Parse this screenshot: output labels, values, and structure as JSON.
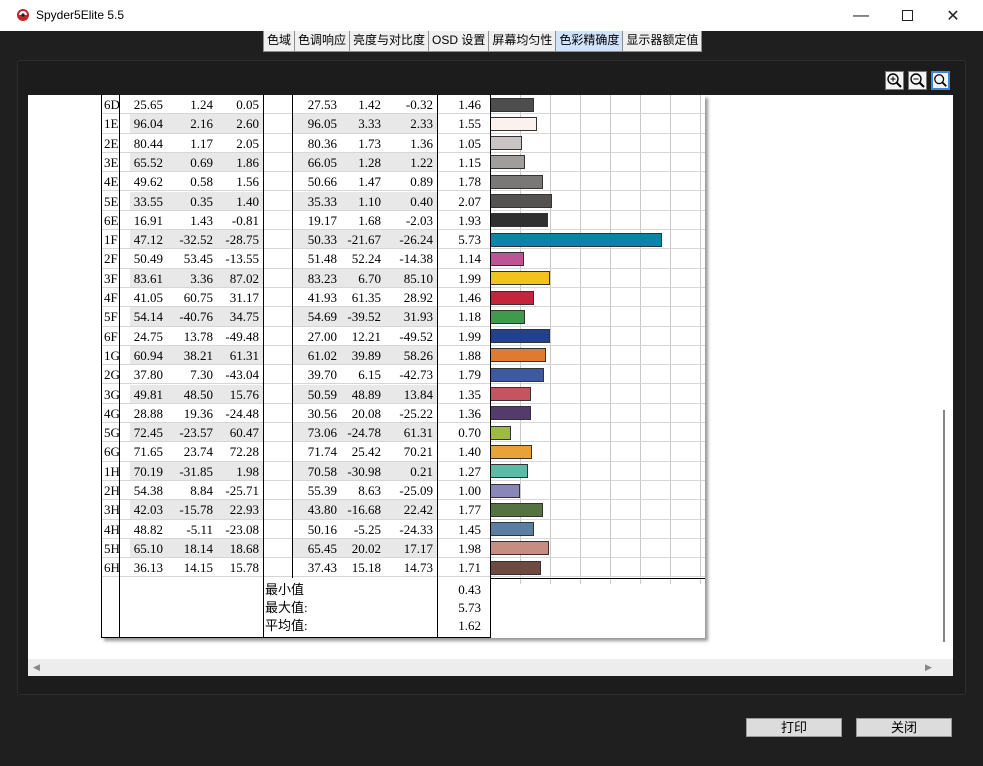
{
  "window": {
    "title": "Spyder5Elite 5.5"
  },
  "tabs": [
    "色域",
    "色调响应",
    "亮度与对比度",
    "OSD 设置",
    "屏幕均匀性",
    "色彩精确度",
    "显示器额定值"
  ],
  "active_tab": "色彩精确度",
  "rows": [
    {
      "patch": "6D",
      "m": [
        "25.65",
        "1.24",
        "0.05"
      ],
      "t": [
        "27.53",
        "1.42",
        "-0.32"
      ],
      "de": "1.46",
      "color": "#4d4d4d"
    },
    {
      "patch": "1E",
      "m": [
        "96.04",
        "2.16",
        "2.60"
      ],
      "t": [
        "96.05",
        "3.33",
        "2.33"
      ],
      "de": "1.55",
      "color": "#fbf2ef"
    },
    {
      "patch": "2E",
      "m": [
        "80.44",
        "1.17",
        "2.05"
      ],
      "t": [
        "80.36",
        "1.73",
        "1.36"
      ],
      "de": "1.05",
      "color": "#c8c5c4"
    },
    {
      "patch": "3E",
      "m": [
        "65.52",
        "0.69",
        "1.86"
      ],
      "t": [
        "66.05",
        "1.28",
        "1.22"
      ],
      "de": "1.15",
      "color": "#a09e9d"
    },
    {
      "patch": "4E",
      "m": [
        "49.62",
        "0.58",
        "1.56"
      ],
      "t": [
        "50.66",
        "1.47",
        "0.89"
      ],
      "de": "1.78",
      "color": "#7a7876"
    },
    {
      "patch": "5E",
      "m": [
        "33.55",
        "0.35",
        "1.40"
      ],
      "t": [
        "35.33",
        "1.10",
        "0.40"
      ],
      "de": "2.07",
      "color": "#555352"
    },
    {
      "patch": "6E",
      "m": [
        "16.91",
        "1.43",
        "-0.81"
      ],
      "t": [
        "19.17",
        "1.68",
        "-2.03"
      ],
      "de": "1.93",
      "color": "#303031"
    },
    {
      "patch": "1F",
      "m": [
        "47.12",
        "-32.52",
        "-28.75"
      ],
      "t": [
        "50.33",
        "-21.67",
        "-26.24"
      ],
      "de": "5.73",
      "color": "#0a85a9"
    },
    {
      "patch": "2F",
      "m": [
        "50.49",
        "53.45",
        "-13.55"
      ],
      "t": [
        "51.48",
        "52.24",
        "-14.38"
      ],
      "de": "1.14",
      "color": "#bf5495"
    },
    {
      "patch": "3F",
      "m": [
        "83.61",
        "3.36",
        "87.02"
      ],
      "t": [
        "83.23",
        "6.70",
        "85.10"
      ],
      "de": "1.99",
      "color": "#f2c31e"
    },
    {
      "patch": "4F",
      "m": [
        "41.05",
        "60.75",
        "31.17"
      ],
      "t": [
        "41.93",
        "61.35",
        "28.92"
      ],
      "de": "1.46",
      "color": "#c3263b"
    },
    {
      "patch": "5F",
      "m": [
        "54.14",
        "-40.76",
        "34.75"
      ],
      "t": [
        "54.69",
        "-39.52",
        "31.93"
      ],
      "de": "1.18",
      "color": "#3e9a4d"
    },
    {
      "patch": "6F",
      "m": [
        "24.75",
        "13.78",
        "-49.48"
      ],
      "t": [
        "27.00",
        "12.21",
        "-49.52"
      ],
      "de": "1.99",
      "color": "#22428f"
    },
    {
      "patch": "1G",
      "m": [
        "60.94",
        "38.21",
        "61.31"
      ],
      "t": [
        "61.02",
        "39.89",
        "58.26"
      ],
      "de": "1.88",
      "color": "#e07a31"
    },
    {
      "patch": "2G",
      "m": [
        "37.80",
        "7.30",
        "-43.04"
      ],
      "t": [
        "39.70",
        "6.15",
        "-42.73"
      ],
      "de": "1.79",
      "color": "#3f599f"
    },
    {
      "patch": "3G",
      "m": [
        "49.81",
        "48.50",
        "15.76"
      ],
      "t": [
        "50.59",
        "48.89",
        "13.84"
      ],
      "de": "1.35",
      "color": "#c4545f"
    },
    {
      "patch": "4G",
      "m": [
        "28.88",
        "19.36",
        "-24.48"
      ],
      "t": [
        "30.56",
        "20.08",
        "-25.22"
      ],
      "de": "1.36",
      "color": "#533b6c"
    },
    {
      "patch": "5G",
      "m": [
        "72.45",
        "-23.57",
        "60.47"
      ],
      "t": [
        "73.06",
        "-24.78",
        "61.31"
      ],
      "de": "0.70",
      "color": "#9dbb3e"
    },
    {
      "patch": "6G",
      "m": [
        "71.65",
        "23.74",
        "72.28"
      ],
      "t": [
        "71.74",
        "25.42",
        "70.21"
      ],
      "de": "1.40",
      "color": "#e9a238"
    },
    {
      "patch": "1H",
      "m": [
        "70.19",
        "-31.85",
        "1.98"
      ],
      "t": [
        "70.58",
        "-30.98",
        "0.21"
      ],
      "de": "1.27",
      "color": "#5dbaa7"
    },
    {
      "patch": "2H",
      "m": [
        "54.38",
        "8.84",
        "-25.71"
      ],
      "t": [
        "55.39",
        "8.63",
        "-25.09"
      ],
      "de": "1.00",
      "color": "#8987b8"
    },
    {
      "patch": "3H",
      "m": [
        "42.03",
        "-15.78",
        "22.93"
      ],
      "t": [
        "43.80",
        "-16.68",
        "22.42"
      ],
      "de": "1.77",
      "color": "#557342"
    },
    {
      "patch": "4H",
      "m": [
        "48.82",
        "-5.11",
        "-23.08"
      ],
      "t": [
        "50.16",
        "-5.25",
        "-24.33"
      ],
      "de": "1.45",
      "color": "#5b7fa3"
    },
    {
      "patch": "5H",
      "m": [
        "65.10",
        "18.14",
        "18.68"
      ],
      "t": [
        "65.45",
        "20.02",
        "17.17"
      ],
      "de": "1.98",
      "color": "#c78c82"
    },
    {
      "patch": "6H",
      "m": [
        "36.13",
        "14.15",
        "15.78"
      ],
      "t": [
        "37.43",
        "15.18",
        "14.73"
      ],
      "de": "1.71",
      "color": "#6e4a40"
    }
  ],
  "chart_data": {
    "type": "bar",
    "orientation": "horizontal",
    "xlim": [
      0,
      8
    ]
  },
  "summary": [
    {
      "label": "最小值",
      "value": "0.43"
    },
    {
      "label": "最大值:",
      "value": "5.73"
    },
    {
      "label": "平均值:",
      "value": "1.62"
    }
  ],
  "footer": {
    "print_label": "打印",
    "close_label": "关闭"
  },
  "colors": {
    "active_tab": "#cfe3fb",
    "zoom_selected": "#3d86d6"
  }
}
